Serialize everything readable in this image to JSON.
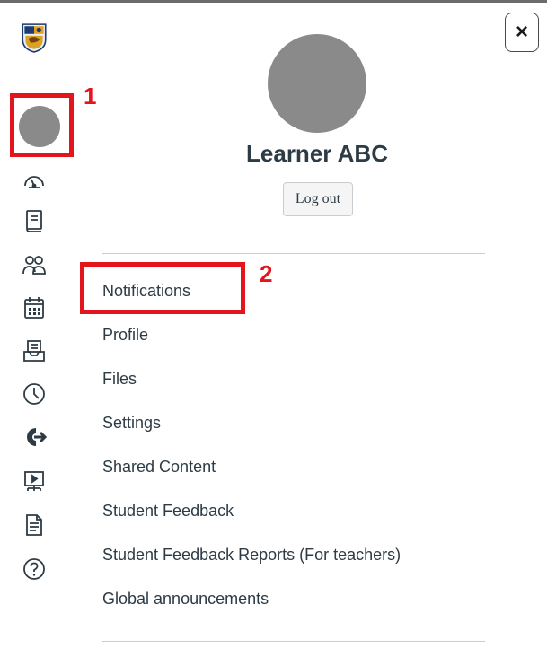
{
  "profile": {
    "user_name": "Learner ABC",
    "logout_label": "Log out",
    "close_label": "×"
  },
  "menu": {
    "items": [
      {
        "label": "Notifications"
      },
      {
        "label": "Profile"
      },
      {
        "label": "Files"
      },
      {
        "label": "Settings"
      },
      {
        "label": "Shared Content"
      },
      {
        "label": "Student Feedback"
      },
      {
        "label": "Student Feedback Reports (For teachers)"
      },
      {
        "label": "Global announcements"
      }
    ]
  },
  "nav_rail": {
    "items": [
      {
        "icon": "university-crest-logo"
      },
      {
        "icon": "account-avatar"
      },
      {
        "icon": "dashboard-icon"
      },
      {
        "icon": "courses-icon"
      },
      {
        "icon": "groups-icon"
      },
      {
        "icon": "calendar-icon"
      },
      {
        "icon": "inbox-icon"
      },
      {
        "icon": "history-icon"
      },
      {
        "icon": "commons-icon"
      },
      {
        "icon": "studio-icon"
      },
      {
        "icon": "document-icon"
      },
      {
        "icon": "help-icon"
      }
    ]
  },
  "annotations": {
    "callout_1": "1",
    "callout_2": "2"
  },
  "colors": {
    "callout": "#e3141b",
    "text": "#2d3b45",
    "avatar": "#8a8a8a",
    "icon": "#2d3b45"
  }
}
